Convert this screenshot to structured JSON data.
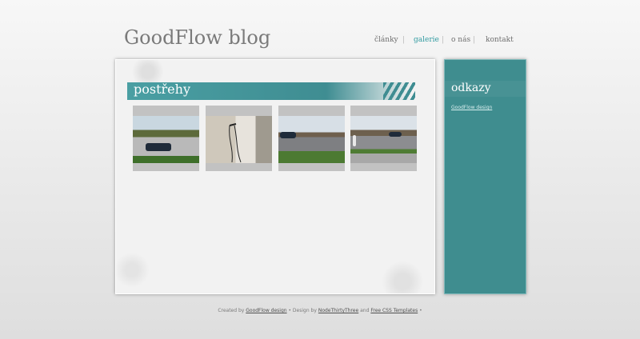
{
  "header": {
    "site_title": "GoodFlow blog",
    "nav": [
      {
        "label": "články",
        "active": false
      },
      {
        "label": "galerie",
        "active": true
      },
      {
        "label": "o nás",
        "active": false
      },
      {
        "label": "kontakt",
        "active": false
      }
    ],
    "separator": "|"
  },
  "main": {
    "section_title": "postřehy",
    "thumbnails": [
      {
        "image": "photo-parking-lot-car"
      },
      {
        "image": "photo-wall-cables"
      },
      {
        "image": "photo-road-car"
      },
      {
        "image": "photo-road-cyclist"
      }
    ]
  },
  "sidebar": {
    "title": "odkazy",
    "links": [
      {
        "label": "GoodFlow design"
      }
    ]
  },
  "footer": {
    "created_by_text": "Created by",
    "goodflow_link": "GoodFlow design",
    "design_by_text": "• Design by",
    "designer_link": "NodeThirtyThree",
    "and_text": "and",
    "templates_link": "Free CSS Templates",
    "end_text": "•"
  },
  "colors": {
    "accent": "#2f9aa0",
    "teal_panel": "#3f8d8f",
    "background": "#e6e6e6"
  }
}
